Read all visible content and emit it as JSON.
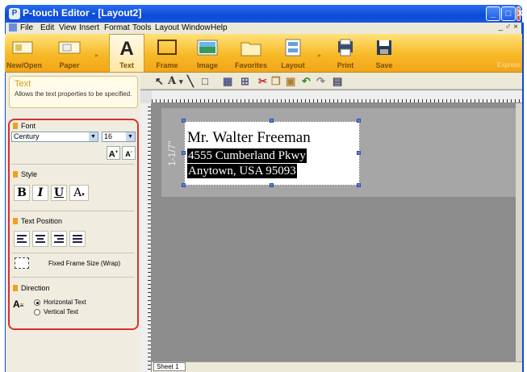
{
  "window": {
    "title": "P-touch Editor - [Layout2]",
    "app_icon": "ptouch-icon",
    "controls": [
      "_",
      "□",
      "X"
    ]
  },
  "menu": {
    "items": [
      "File",
      "Edit",
      "View",
      "Insert",
      "Format",
      "Tools",
      "Layout",
      "Window",
      "Help"
    ],
    "right_controls": "_ ♂ ×"
  },
  "toolbar": {
    "buttons": [
      {
        "label": "New/Open",
        "icon": "new-open-icon"
      },
      {
        "label": "Paper",
        "icon": "paper-icon"
      },
      {
        "label": "Text",
        "icon": "text-icon"
      },
      {
        "label": "Frame",
        "icon": "frame-icon"
      },
      {
        "label": "Image",
        "icon": "image-icon"
      },
      {
        "label": "Favorites",
        "icon": "favorites-icon"
      },
      {
        "label": "Layout",
        "icon": "layout-icon"
      },
      {
        "label": "Print",
        "icon": "print-icon"
      },
      {
        "label": "Save",
        "icon": "save-icon"
      }
    ],
    "right_label": "Express",
    "accent": "#f7b927"
  },
  "sidebar": {
    "help": {
      "title": "Text",
      "description": "Allows the text properties to be specified."
    },
    "font": {
      "heading": "Font",
      "family": "Century",
      "size": "16",
      "grow_btn": "A",
      "shrink_btn": "A"
    },
    "style": {
      "heading": "Style",
      "bold": "B",
      "italic": "I",
      "underline": "U",
      "effect": "A"
    },
    "position": {
      "heading": "Text Position"
    },
    "wrap": {
      "label": "Fixed Frame Size (Wrap)"
    },
    "direction": {
      "heading": "Direction",
      "horizontal": "Horizontal Text",
      "vertical": "Vertical Text",
      "selected": "horizontal"
    },
    "panel_outline_color": "#d83030"
  },
  "canvas": {
    "length_label": "1-1/7\"",
    "lines": [
      "Mr. Walter Freeman",
      "4555 Cumberland Pkwy",
      "Anytown, USA 95093"
    ],
    "selected_lines": [
      2,
      3
    ],
    "sheet_tab": "Sheet 1"
  },
  "edit_tools": [
    "arrow-icon",
    "text-tool-icon",
    "line-tool-icon",
    "frame-tool-icon",
    "table-icon",
    "cut-icon",
    "copy-icon",
    "paste-icon",
    "undo-icon",
    "redo-icon",
    "properties-icon"
  ]
}
